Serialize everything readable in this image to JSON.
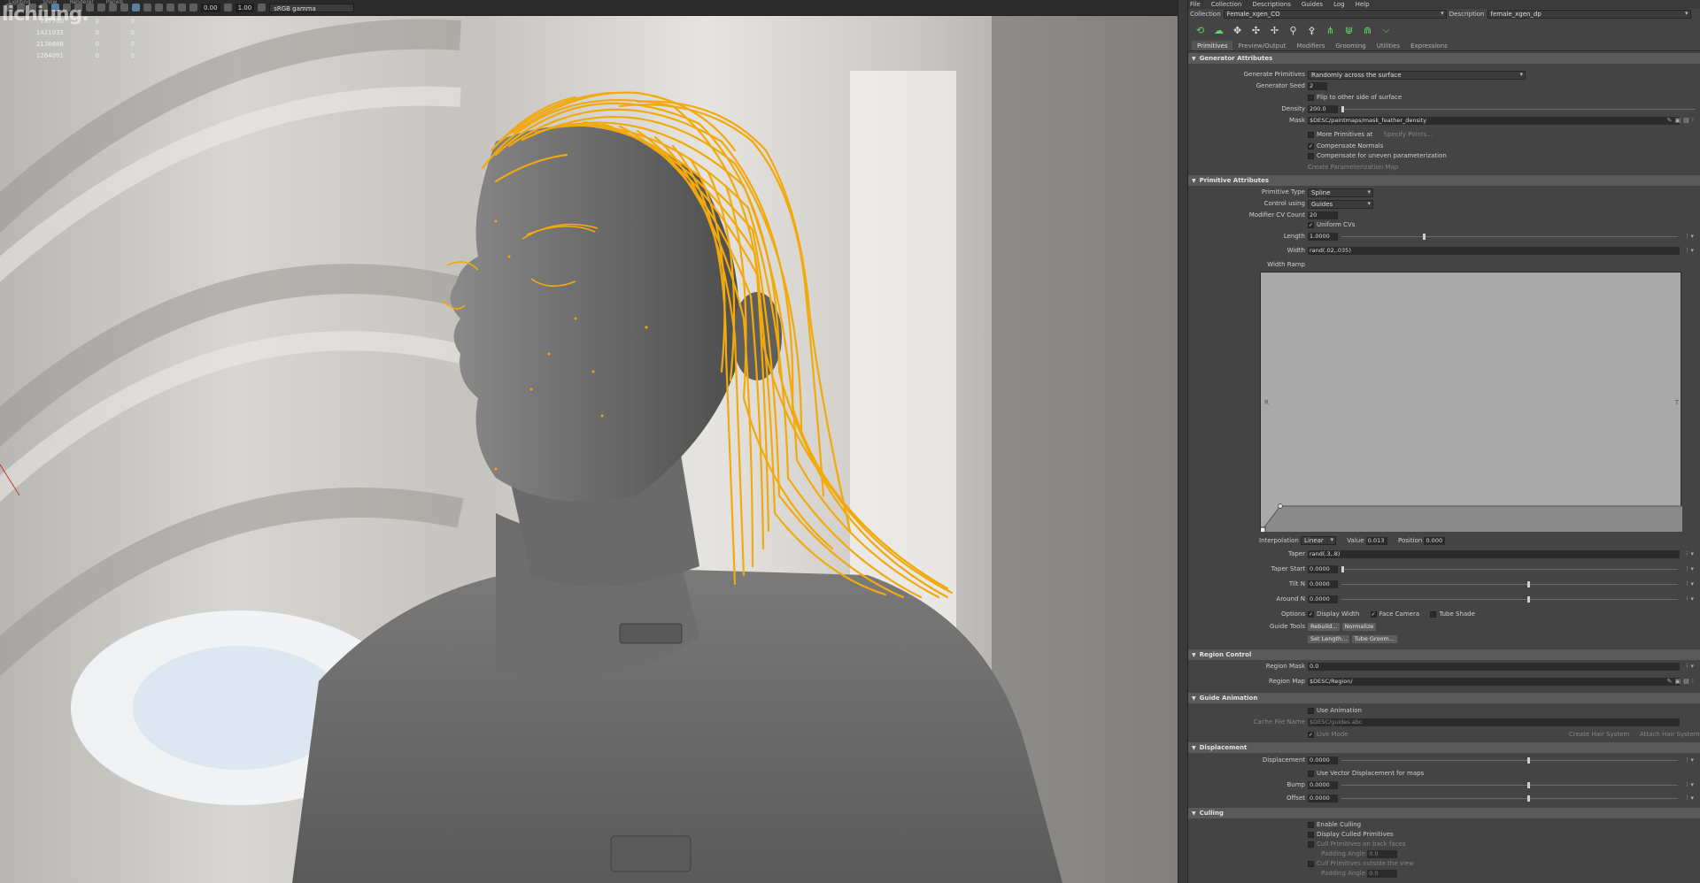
{
  "viewport": {
    "menu": [
      "Renderer",
      "Lighting",
      "Show",
      "Renderer",
      "Panels"
    ],
    "watermark": "lichiung.",
    "toolbar_values": {
      "exposure": "0.00",
      "gamma": "1.00",
      "colorspace": "sRGB gamma"
    },
    "hud": [
      {
        "c1": "",
        "c2": "787700",
        "c3": "0",
        "c4": "0"
      },
      {
        "c1": "",
        "c2": "1421932",
        "c3": "0",
        "c4": "0"
      },
      {
        "c1": "",
        "c2": "2136688",
        "c3": "0",
        "c4": "0"
      },
      {
        "c1": "",
        "c2": "1264091",
        "c3": "0",
        "c4": "0"
      }
    ],
    "colors": {
      "hair": "#f2a90c",
      "skin": "#6c6c6c"
    }
  },
  "panel": {
    "menubar": [
      "File",
      "Collection",
      "Descriptions",
      "Guides",
      "Log",
      "Help"
    ],
    "collection_label": "Collection",
    "collection_value": "Female_xgen_CO",
    "description_label": "Description",
    "description_value": "female_xgen_dp",
    "tabs": [
      "Primitives",
      "Preview/Output",
      "Modifiers",
      "Grooming",
      "Utilities",
      "Expressions"
    ],
    "generator": {
      "title": "Generator Attributes",
      "generate_primitives_label": "Generate Primitives",
      "generate_primitives_value": "Randomly across the surface",
      "seed_label": "Generator Seed",
      "seed_value": "2",
      "flip_label": "Flip to other side of surface",
      "density_label": "Density",
      "density_value": "200.0",
      "mask_label": "Mask",
      "mask_value": "$DESC/paintmaps/mask_feather_density",
      "more_primitives_label": "More Primitives at",
      "specify_points": "Specify Points...",
      "compensate_normals": "Compensate Normals",
      "compensate_uneven": "Compensate for uneven parameterization",
      "create_param_map": "Create Parameterization Map"
    },
    "primitive": {
      "title": "Primitive Attributes",
      "type_label": "Primitive Type",
      "type_value": "Spline",
      "control_label": "Control using",
      "control_value": "Guides",
      "cv_label": "Modifier CV Count",
      "cv_value": "20",
      "uniform_cvs": "Uniform CVs",
      "length_label": "Length",
      "length_value": "1.0000",
      "width_label": "Width",
      "width_value": "rand(.02,.035)",
      "width_ramp_label": "Width Ramp",
      "ramp_r": "R",
      "ramp_t": "T",
      "interp_label": "Interpolation",
      "interp_value": "Linear",
      "value_label": "Value",
      "value_value": "0.013",
      "position_label": "Position",
      "position_value": "0.000",
      "taper_label": "Taper",
      "taper_value": "rand(.3,.8)",
      "taper_start_label": "Taper Start",
      "taper_start_value": "0.0000",
      "tilt_label": "Tilt N",
      "tilt_value": "0.0000",
      "around_label": "Around N",
      "around_value": "0.0000",
      "options_label": "Options",
      "display_width": "Display Width",
      "face_camera": "Face Camera",
      "tube_shade": "Tube Shade",
      "guide_tools_label": "Guide Tools",
      "rebuild": "Rebuild...",
      "normalize": "Normalize",
      "set_length": "Set Length...",
      "tube_groom": "Tube Groom..."
    },
    "region": {
      "title": "Region Control",
      "mask_label": "Region Mask",
      "mask_value": "0.0",
      "map_label": "Region Map",
      "map_value": "$DESC/Region/"
    },
    "guide_anim": {
      "title": "Guide Animation",
      "use_animation": "Use Animation",
      "cache_label": "Cache File Name",
      "cache_value": "$DESC/guides.abc",
      "live_mode": "Live Mode",
      "create_hair": "Create Hair System",
      "attach_hair": "Attach Hair System"
    },
    "displacement": {
      "title": "Displacement",
      "disp_label": "Displacement",
      "disp_value": "0.0000",
      "use_vector": "Use Vector Displacement for maps",
      "bump_label": "Bump",
      "bump_value": "0.0000",
      "offset_label": "Offset",
      "offset_value": "0.0000"
    },
    "culling": {
      "title": "Culling",
      "enable": "Enable Culling",
      "display": "Display Culled Primitives",
      "back_faces": "Cull Primitives on back faces",
      "padding_label": "Padding Angle",
      "padding_value": "0.0",
      "outside": "Cull Primitives outside the view",
      "padding2_label": "Padding Angle",
      "padding2_value": "0.0"
    }
  }
}
